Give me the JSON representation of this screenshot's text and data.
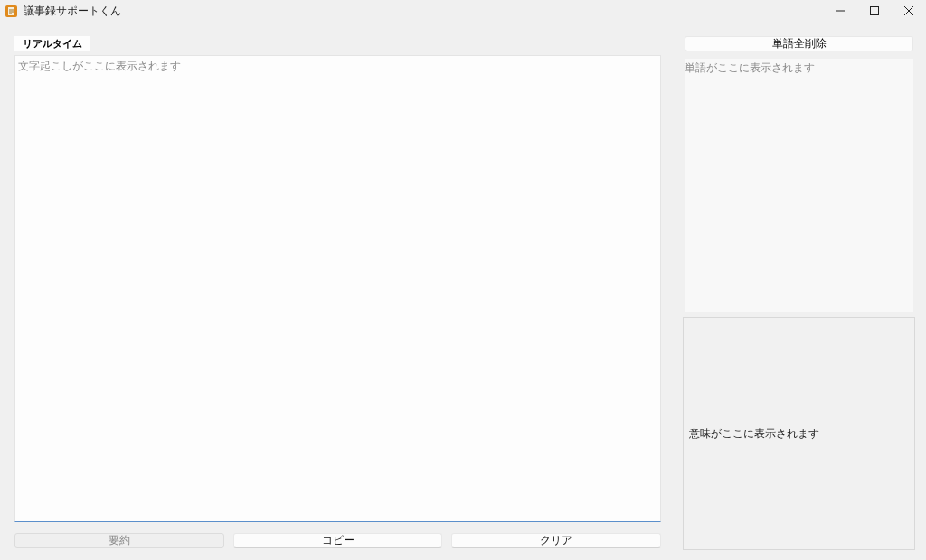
{
  "window": {
    "title": "議事録サポートくん"
  },
  "tabs": [
    {
      "label": "リアルタイム",
      "selected": true
    }
  ],
  "transcript": {
    "placeholder": "文字起こしがここに表示されます"
  },
  "buttons": [
    {
      "label": "要約",
      "disabled": true
    },
    {
      "label": "コピー",
      "disabled": false
    },
    {
      "label": "クリア",
      "disabled": false
    }
  ],
  "words": {
    "clear_button": "単語全削除",
    "placeholder": "単語がここに表示されます"
  },
  "meaning": {
    "text": "意味がここに表示されます"
  }
}
